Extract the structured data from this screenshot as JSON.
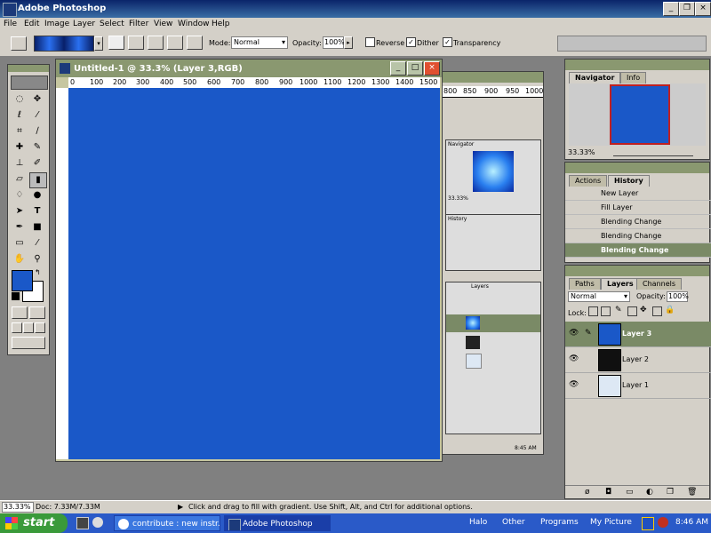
{
  "app": {
    "title": "Adobe Photoshop"
  },
  "menu": [
    "File",
    "Edit",
    "Image",
    "Layer",
    "Select",
    "Filter",
    "View",
    "Window",
    "Help"
  ],
  "options": {
    "mode_label": "Mode:",
    "mode_value": "Normal",
    "opacity_label": "Opacity:",
    "opacity_value": "100%",
    "reverse_label": "Reverse",
    "dither_label": "Dither",
    "transparency_label": "Transparency",
    "reverse_checked": false,
    "dither_checked": true,
    "transparency_checked": true
  },
  "document": {
    "title": "Untitled-1 @ 33.3% (Layer 3,RGB)",
    "canvas_color": "#1a58c8",
    "ruler_labels": [
      "0",
      "100",
      "200",
      "300",
      "400",
      "500",
      "600",
      "700",
      "800",
      "900",
      "1000",
      "1100",
      "1200",
      "1300",
      "1400",
      "1500"
    ]
  },
  "bg_window": {
    "ruler_labels": [
      "800",
      "850",
      "900",
      "950",
      "1000"
    ],
    "zoom": "33.33%",
    "tabs": [
      "Navigator",
      "Info"
    ],
    "history_tabs": [
      "Actions",
      "History"
    ],
    "layers_tabs": [
      "Paths",
      "Layers",
      "Channels"
    ],
    "time": "8:45 AM"
  },
  "navigator": {
    "tabs": [
      "Navigator",
      "Info"
    ],
    "zoom": "33.33%"
  },
  "history": {
    "tabs": [
      "Actions",
      "History"
    ],
    "items": [
      "New Layer",
      "Fill Layer",
      "Blending Change",
      "Blending Change",
      "Blending Change"
    ]
  },
  "layers": {
    "tabs": [
      "Paths",
      "Layers",
      "Channels"
    ],
    "mode": "Normal",
    "opacity_label": "Opacity:",
    "opacity_value": "100%",
    "lock_label": "Lock:",
    "rows": [
      {
        "name": "Layer 3",
        "thumb": "#1a58c8",
        "selected": true
      },
      {
        "name": "Layer 2",
        "thumb": "#101010",
        "selected": false
      },
      {
        "name": "Layer 1",
        "thumb": "#dde8f4",
        "selected": false
      }
    ]
  },
  "status": {
    "zoom": "33.33%",
    "doc": "Doc: 7.33M/7.33M",
    "hint": "Click and drag to fill with gradient.  Use Shift, Alt, and Ctrl for additional options."
  },
  "taskbar": {
    "start": "start",
    "items": [
      "contribute : new instr...",
      "Adobe Photoshop"
    ],
    "tray_items": [
      "Halo",
      "Other",
      "Programs",
      "My Picture"
    ],
    "time": "8:46 AM"
  },
  "colors": {
    "foreground": "#1a58c8",
    "background": "#ffffff",
    "panel_title": "#8a9870",
    "selected_row": "#7a8a66"
  }
}
